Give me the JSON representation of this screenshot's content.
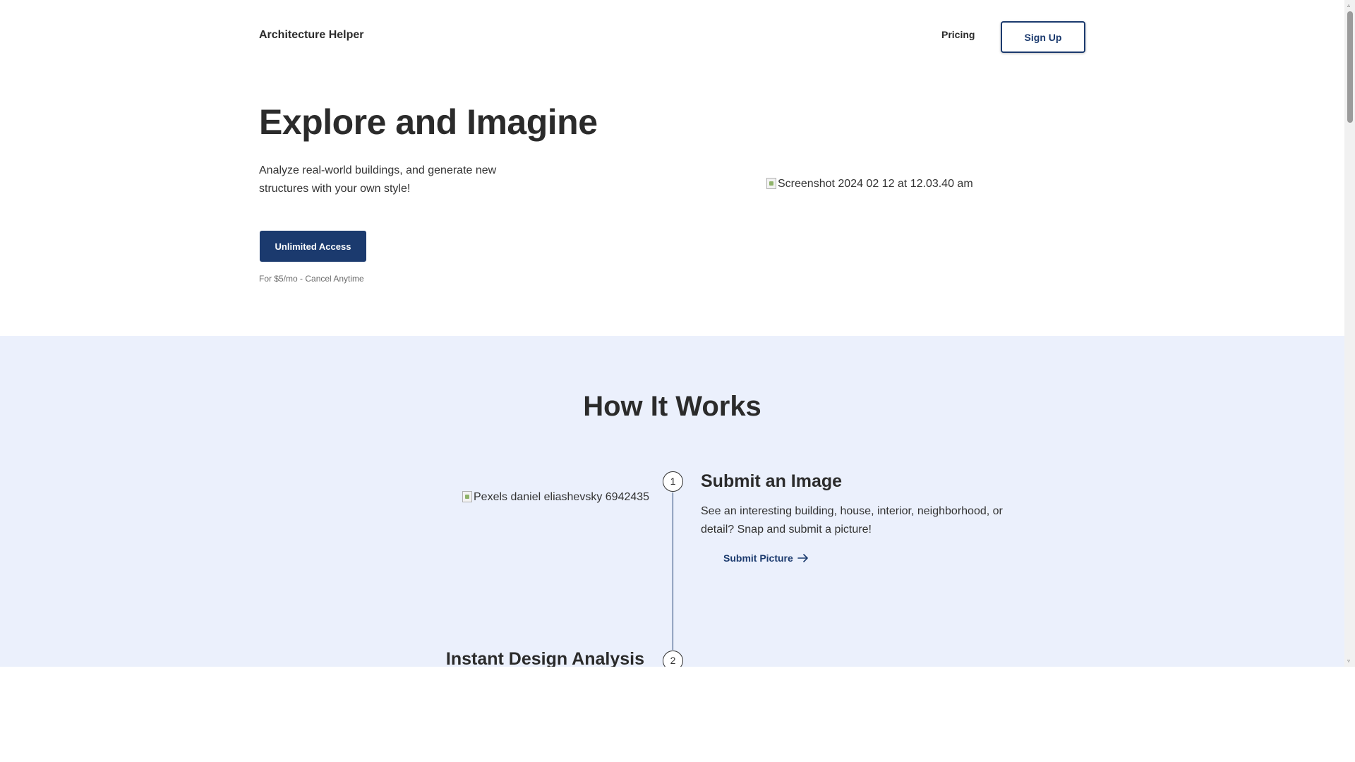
{
  "header": {
    "brand": "Architecture Helper",
    "nav_pricing": "Pricing",
    "signup_label": "Sign Up"
  },
  "hero": {
    "title": "Explore and Imagine",
    "subtitle": "Analyze real-world buildings, and generate new structures with your own style!",
    "cta_label": "Unlimited Access",
    "cta_note": "For $5/mo - Cancel Anytime",
    "image_alt": "Screenshot 2024 02 12 at 12.03.40 am"
  },
  "how_it_works": {
    "title": "How It Works",
    "steps": [
      {
        "number": "1",
        "title": "Submit an Image",
        "description": "See an interesting building, house, interior, neighborhood, or detail? Snap and submit a picture!",
        "link_label": "Submit Picture",
        "image_alt": "Pexels daniel eliashevsky 6942435"
      },
      {
        "number": "2",
        "title": "Instant Design Analysis"
      }
    ]
  },
  "icons": {
    "broken_image": "broken-image-icon",
    "arrow": "arrow-right-icon"
  },
  "colors": {
    "primary": "#1b3a6e",
    "section_bg": "#ebf0fc",
    "text": "#2b2b2b"
  }
}
